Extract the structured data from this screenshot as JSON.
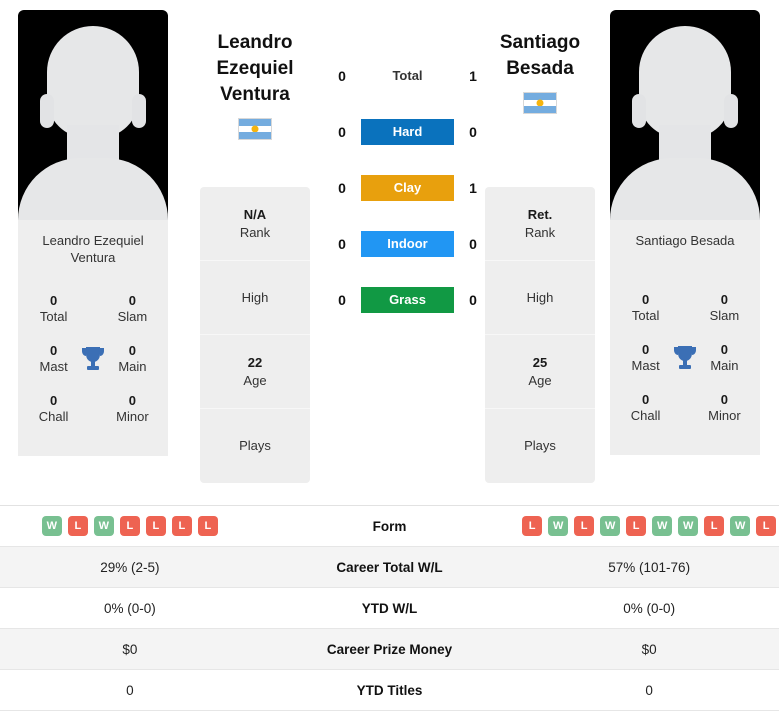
{
  "players": {
    "left": {
      "name": "Leandro Ezequiel Ventura",
      "name_line1": "Leandro Ezequiel",
      "name_line2": "Ventura",
      "caption": "Leandro Ezequiel Ventura",
      "country": "Argentina",
      "flag_icon": "argentina-flag-icon",
      "rank_value": "N/A",
      "rank_label": "Rank",
      "high_label": "High",
      "high_value": "",
      "age_value": "22",
      "age_label": "Age",
      "plays_label": "Plays",
      "plays_value": "",
      "titles": [
        {
          "num": "0",
          "label": "Total"
        },
        {
          "num": "0",
          "label": "Slam"
        },
        {
          "num": "0",
          "label": "Mast"
        },
        {
          "num": "0",
          "label": "Main"
        },
        {
          "num": "0",
          "label": "Chall"
        },
        {
          "num": "0",
          "label": "Minor"
        }
      ],
      "form": [
        "W",
        "L",
        "W",
        "L",
        "L",
        "L",
        "L"
      ]
    },
    "right": {
      "name": "Santiago Besada",
      "name_line1": "Santiago",
      "name_line2": "Besada",
      "caption": "Santiago Besada",
      "country": "Argentina",
      "flag_icon": "argentina-flag-icon",
      "rank_value": "Ret.",
      "rank_label": "Rank",
      "high_label": "High",
      "high_value": "",
      "age_value": "25",
      "age_label": "Age",
      "plays_label": "Plays",
      "plays_value": "",
      "titles": [
        {
          "num": "0",
          "label": "Total"
        },
        {
          "num": "0",
          "label": "Slam"
        },
        {
          "num": "0",
          "label": "Mast"
        },
        {
          "num": "0",
          "label": "Main"
        },
        {
          "num": "0",
          "label": "Chall"
        },
        {
          "num": "0",
          "label": "Minor"
        }
      ],
      "form": [
        "L",
        "W",
        "L",
        "W",
        "L",
        "W",
        "W",
        "L",
        "W",
        "L"
      ]
    }
  },
  "h2h": {
    "rows": [
      {
        "left": "0",
        "label": "Total",
        "right": "1",
        "color": "",
        "style": "plain"
      },
      {
        "left": "0",
        "label": "Hard",
        "right": "0",
        "color": "#0a72bd",
        "style": "pill"
      },
      {
        "left": "0",
        "label": "Clay",
        "right": "1",
        "color": "#e8a00d",
        "style": "pill"
      },
      {
        "left": "0",
        "label": "Indoor",
        "right": "0",
        "color": "#2196f3",
        "style": "pill"
      },
      {
        "left": "0",
        "label": "Grass",
        "right": "0",
        "color": "#119944",
        "style": "pill"
      }
    ]
  },
  "stats_table": {
    "rows": [
      {
        "label": "Form",
        "left": "",
        "right": "",
        "type": "form",
        "shaded": false
      },
      {
        "label": "Career Total W/L",
        "left": "29% (2-5)",
        "right": "57% (101-76)",
        "type": "text",
        "shaded": true
      },
      {
        "label": "YTD W/L",
        "left": "0% (0-0)",
        "right": "0% (0-0)",
        "type": "text",
        "shaded": false
      },
      {
        "label": "Career Prize Money",
        "left": "$0",
        "right": "$0",
        "type": "text",
        "shaded": true
      },
      {
        "label": "YTD Titles",
        "left": "0",
        "right": "0",
        "type": "text",
        "shaded": false
      }
    ]
  },
  "icons": {
    "trophy": "trophy-icon",
    "avatar": "player-avatar-placeholder-icon"
  },
  "colors": {
    "hard": "#0a72bd",
    "clay": "#e8a00d",
    "indoor": "#2196f3",
    "grass": "#119944",
    "win": "#78c091",
    "loss": "#ee6352",
    "trophy": "#3b6fb5",
    "card_bg": "#eeeeee"
  }
}
